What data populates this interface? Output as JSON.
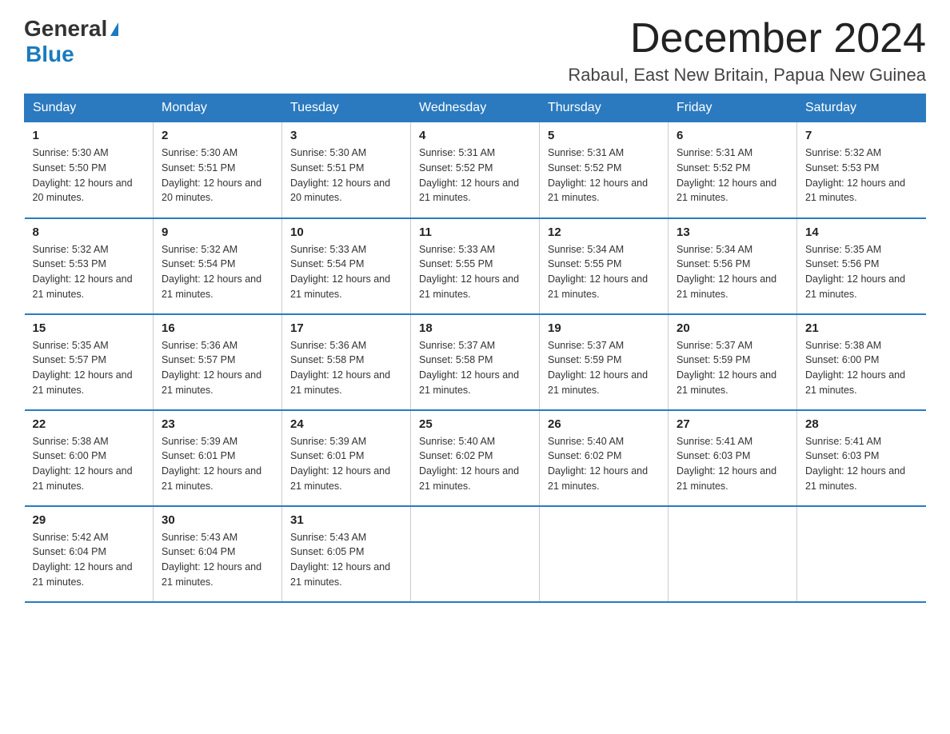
{
  "logo": {
    "general": "General",
    "blue": "Blue"
  },
  "title": {
    "month_year": "December 2024",
    "location": "Rabaul, East New Britain, Papua New Guinea"
  },
  "weekdays": [
    "Sunday",
    "Monday",
    "Tuesday",
    "Wednesday",
    "Thursday",
    "Friday",
    "Saturday"
  ],
  "weeks": [
    [
      {
        "day": "1",
        "sunrise": "Sunrise: 5:30 AM",
        "sunset": "Sunset: 5:50 PM",
        "daylight": "Daylight: 12 hours and 20 minutes."
      },
      {
        "day": "2",
        "sunrise": "Sunrise: 5:30 AM",
        "sunset": "Sunset: 5:51 PM",
        "daylight": "Daylight: 12 hours and 20 minutes."
      },
      {
        "day": "3",
        "sunrise": "Sunrise: 5:30 AM",
        "sunset": "Sunset: 5:51 PM",
        "daylight": "Daylight: 12 hours and 20 minutes."
      },
      {
        "day": "4",
        "sunrise": "Sunrise: 5:31 AM",
        "sunset": "Sunset: 5:52 PM",
        "daylight": "Daylight: 12 hours and 21 minutes."
      },
      {
        "day": "5",
        "sunrise": "Sunrise: 5:31 AM",
        "sunset": "Sunset: 5:52 PM",
        "daylight": "Daylight: 12 hours and 21 minutes."
      },
      {
        "day": "6",
        "sunrise": "Sunrise: 5:31 AM",
        "sunset": "Sunset: 5:52 PM",
        "daylight": "Daylight: 12 hours and 21 minutes."
      },
      {
        "day": "7",
        "sunrise": "Sunrise: 5:32 AM",
        "sunset": "Sunset: 5:53 PM",
        "daylight": "Daylight: 12 hours and 21 minutes."
      }
    ],
    [
      {
        "day": "8",
        "sunrise": "Sunrise: 5:32 AM",
        "sunset": "Sunset: 5:53 PM",
        "daylight": "Daylight: 12 hours and 21 minutes."
      },
      {
        "day": "9",
        "sunrise": "Sunrise: 5:32 AM",
        "sunset": "Sunset: 5:54 PM",
        "daylight": "Daylight: 12 hours and 21 minutes."
      },
      {
        "day": "10",
        "sunrise": "Sunrise: 5:33 AM",
        "sunset": "Sunset: 5:54 PM",
        "daylight": "Daylight: 12 hours and 21 minutes."
      },
      {
        "day": "11",
        "sunrise": "Sunrise: 5:33 AM",
        "sunset": "Sunset: 5:55 PM",
        "daylight": "Daylight: 12 hours and 21 minutes."
      },
      {
        "day": "12",
        "sunrise": "Sunrise: 5:34 AM",
        "sunset": "Sunset: 5:55 PM",
        "daylight": "Daylight: 12 hours and 21 minutes."
      },
      {
        "day": "13",
        "sunrise": "Sunrise: 5:34 AM",
        "sunset": "Sunset: 5:56 PM",
        "daylight": "Daylight: 12 hours and 21 minutes."
      },
      {
        "day": "14",
        "sunrise": "Sunrise: 5:35 AM",
        "sunset": "Sunset: 5:56 PM",
        "daylight": "Daylight: 12 hours and 21 minutes."
      }
    ],
    [
      {
        "day": "15",
        "sunrise": "Sunrise: 5:35 AM",
        "sunset": "Sunset: 5:57 PM",
        "daylight": "Daylight: 12 hours and 21 minutes."
      },
      {
        "day": "16",
        "sunrise": "Sunrise: 5:36 AM",
        "sunset": "Sunset: 5:57 PM",
        "daylight": "Daylight: 12 hours and 21 minutes."
      },
      {
        "day": "17",
        "sunrise": "Sunrise: 5:36 AM",
        "sunset": "Sunset: 5:58 PM",
        "daylight": "Daylight: 12 hours and 21 minutes."
      },
      {
        "day": "18",
        "sunrise": "Sunrise: 5:37 AM",
        "sunset": "Sunset: 5:58 PM",
        "daylight": "Daylight: 12 hours and 21 minutes."
      },
      {
        "day": "19",
        "sunrise": "Sunrise: 5:37 AM",
        "sunset": "Sunset: 5:59 PM",
        "daylight": "Daylight: 12 hours and 21 minutes."
      },
      {
        "day": "20",
        "sunrise": "Sunrise: 5:37 AM",
        "sunset": "Sunset: 5:59 PM",
        "daylight": "Daylight: 12 hours and 21 minutes."
      },
      {
        "day": "21",
        "sunrise": "Sunrise: 5:38 AM",
        "sunset": "Sunset: 6:00 PM",
        "daylight": "Daylight: 12 hours and 21 minutes."
      }
    ],
    [
      {
        "day": "22",
        "sunrise": "Sunrise: 5:38 AM",
        "sunset": "Sunset: 6:00 PM",
        "daylight": "Daylight: 12 hours and 21 minutes."
      },
      {
        "day": "23",
        "sunrise": "Sunrise: 5:39 AM",
        "sunset": "Sunset: 6:01 PM",
        "daylight": "Daylight: 12 hours and 21 minutes."
      },
      {
        "day": "24",
        "sunrise": "Sunrise: 5:39 AM",
        "sunset": "Sunset: 6:01 PM",
        "daylight": "Daylight: 12 hours and 21 minutes."
      },
      {
        "day": "25",
        "sunrise": "Sunrise: 5:40 AM",
        "sunset": "Sunset: 6:02 PM",
        "daylight": "Daylight: 12 hours and 21 minutes."
      },
      {
        "day": "26",
        "sunrise": "Sunrise: 5:40 AM",
        "sunset": "Sunset: 6:02 PM",
        "daylight": "Daylight: 12 hours and 21 minutes."
      },
      {
        "day": "27",
        "sunrise": "Sunrise: 5:41 AM",
        "sunset": "Sunset: 6:03 PM",
        "daylight": "Daylight: 12 hours and 21 minutes."
      },
      {
        "day": "28",
        "sunrise": "Sunrise: 5:41 AM",
        "sunset": "Sunset: 6:03 PM",
        "daylight": "Daylight: 12 hours and 21 minutes."
      }
    ],
    [
      {
        "day": "29",
        "sunrise": "Sunrise: 5:42 AM",
        "sunset": "Sunset: 6:04 PM",
        "daylight": "Daylight: 12 hours and 21 minutes."
      },
      {
        "day": "30",
        "sunrise": "Sunrise: 5:43 AM",
        "sunset": "Sunset: 6:04 PM",
        "daylight": "Daylight: 12 hours and 21 minutes."
      },
      {
        "day": "31",
        "sunrise": "Sunrise: 5:43 AM",
        "sunset": "Sunset: 6:05 PM",
        "daylight": "Daylight: 12 hours and 21 minutes."
      },
      null,
      null,
      null,
      null
    ]
  ]
}
